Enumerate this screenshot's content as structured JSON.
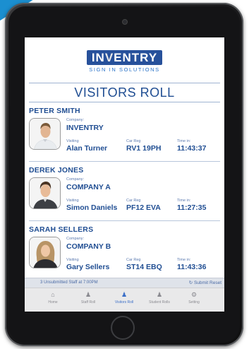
{
  "app": {
    "logo_text_left": "IN",
    "logo_text_v": "V",
    "logo_text_right": "ENTRY",
    "logo_tagline": "SIGN IN SOLUTIONS",
    "title": "VISITORS ROLL"
  },
  "labels": {
    "company": "Company:",
    "visiting": "Visiting",
    "car_reg": "Car Reg",
    "time_in": "Time in:"
  },
  "visitors": [
    {
      "name": "PETER SMITH",
      "company": "INVENTRY",
      "visiting": "Alan Turner",
      "car_reg": "RV1 19PH",
      "time_in": "11:43:37"
    },
    {
      "name": "DEREK JONES",
      "company": "COMPANY A",
      "visiting": "Simon Daniels",
      "car_reg": "PF12 EVA",
      "time_in": "11:27:35"
    },
    {
      "name": "SARAH SELLERS",
      "company": "COMPANY B",
      "visiting": "Gary Sellers",
      "car_reg": "ST14 EBQ",
      "time_in": "11:43:36"
    }
  ],
  "status_bar": {
    "unsubmitted": "3 Unsubmitted Staff at 7:00PM",
    "submit_label": "Submit",
    "reset_label": "Reset"
  },
  "tabs": [
    {
      "label": "Home",
      "icon": "home-icon"
    },
    {
      "label": "Staff Roll",
      "icon": "staff-icon"
    },
    {
      "label": "Visitors Roll",
      "icon": "visitors-icon"
    },
    {
      "label": "Student Rolls",
      "icon": "students-icon"
    },
    {
      "label": "Setting",
      "icon": "gear-icon"
    }
  ],
  "colors": {
    "brand_blue": "#27519b",
    "text_blue": "#1f4d92",
    "active_tab": "#3a6ec7",
    "corner_banner": "#1b8fd0"
  }
}
